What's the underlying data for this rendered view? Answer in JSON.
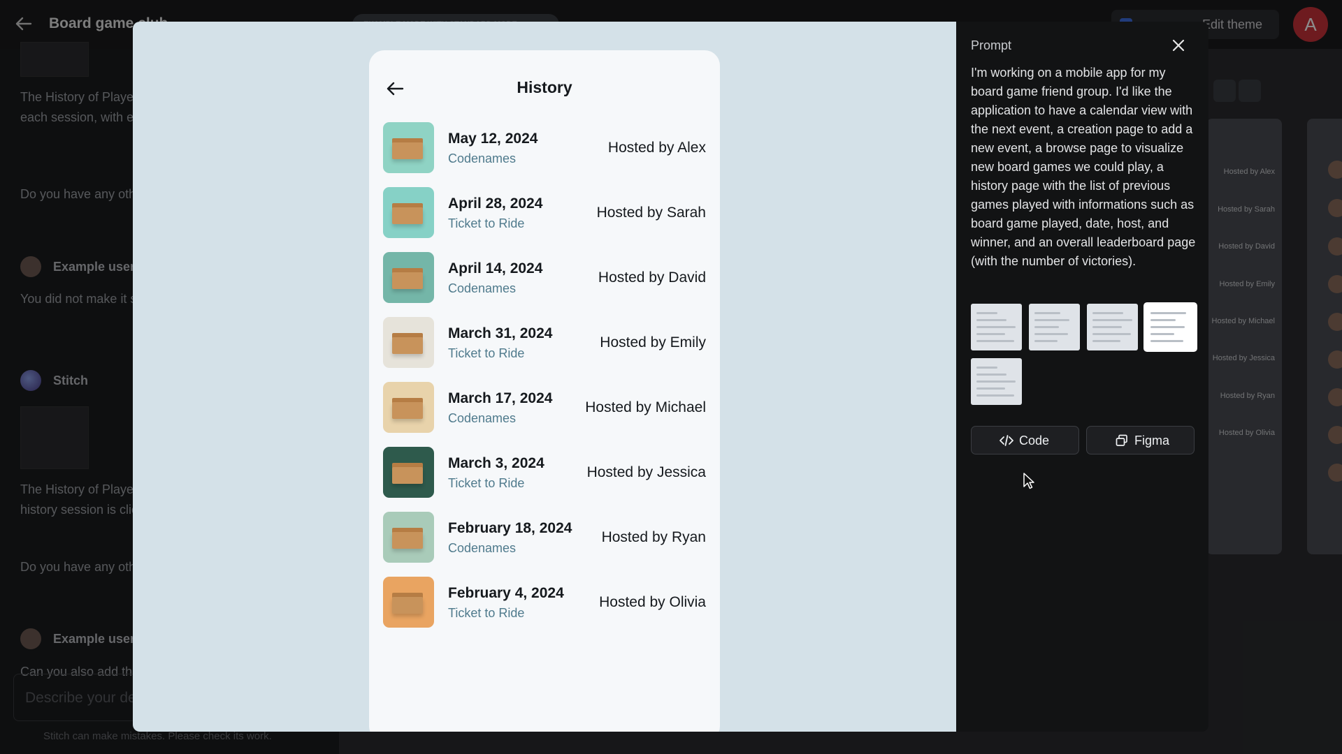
{
  "background_app": {
    "title": "Board game club",
    "pill_label": "EXAMPLE MADE WITH STANDARD MODE",
    "edit_theme": "Edit theme",
    "avatar_letter": "A",
    "chat": {
      "msg1": "The History of Players was updated to include a list of each session, with each one represented as a button.",
      "q1": "Do you have any other features you'd like to explore?",
      "user1_name": "Example user",
      "user1_text": "You did not make it so that each session is clickable.",
      "stitch_name": "Stitch",
      "msg2": "The History of Players was updated to make it so each history session is clickable.",
      "q2": "Do you have any other features you'd like to explore?",
      "user2_name": "Example user",
      "user2_text": "Can you also add the",
      "input_placeholder": "Describe your design",
      "note": "Stitch can make mistakes. Please check its work."
    },
    "canvas_hosts": [
      "Hosted by Alex",
      "Hosted by Sarah",
      "Hosted by David",
      "Hosted by Emily",
      "Hosted by Michael",
      "Hosted by Jessica",
      "Hosted by Ryan",
      "Hosted by Olivia"
    ]
  },
  "preview": {
    "title": "History",
    "items": [
      {
        "date": "May 12, 2024",
        "game": "Codenames",
        "host": "Hosted by Alex",
        "bg": "#8fd3c4"
      },
      {
        "date": "April 28, 2024",
        "game": "Ticket to Ride",
        "host": "Hosted by Sarah",
        "bg": "#86d1c6"
      },
      {
        "date": "April 14, 2024",
        "game": "Codenames",
        "host": "Hosted by David",
        "bg": "#74b6a8"
      },
      {
        "date": "March 31, 2024",
        "game": "Ticket to Ride",
        "host": "Hosted by Emily",
        "bg": "#e6e3da"
      },
      {
        "date": "March 17, 2024",
        "game": "Codenames",
        "host": "Hosted by Michael",
        "bg": "#e8d3ab"
      },
      {
        "date": "March 3, 2024",
        "game": "Ticket to Ride",
        "host": "Hosted by Jessica",
        "bg": "#2e5a4c"
      },
      {
        "date": "February 18, 2024",
        "game": "Codenames",
        "host": "Hosted by Ryan",
        "bg": "#a9cbb9"
      },
      {
        "date": "February 4, 2024",
        "game": "Ticket to Ride",
        "host": "Hosted by Olivia",
        "bg": "#e9a461"
      }
    ]
  },
  "panel": {
    "label": "Prompt",
    "prompt_text": "I'm working on a mobile app for my board game friend group. I'd like the application to have a calendar view with the next event, a creation page to add a new event, a browse page to visualize new board games we could play, a history page with the list of previous games played with informations such as board game played, date, host, and winner, and an overall leaderboard page (with the number of victories).",
    "thumbnails": [
      "home-screen",
      "calendar-screen",
      "browse-screen",
      "history-screen",
      "leaderboard-screen"
    ],
    "selected_thumbnail": 3,
    "code_label": "Code",
    "figma_label": "Figma"
  }
}
